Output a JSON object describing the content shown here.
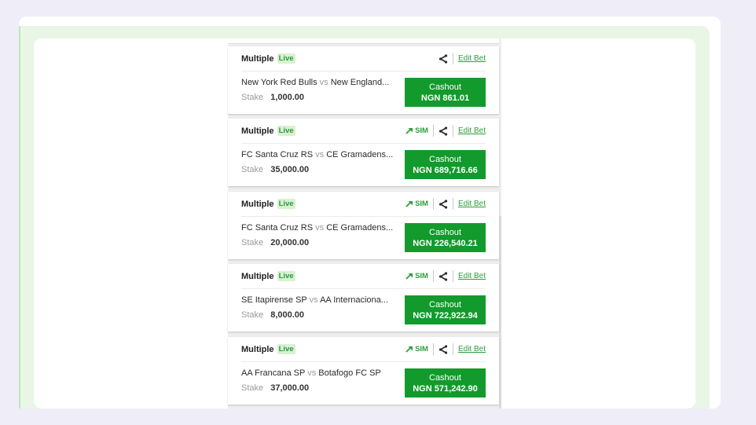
{
  "bets": [
    {
      "type": "Multiple",
      "live": "Live",
      "show_sim": false,
      "sim": "",
      "edit": "Edit Bet",
      "home": "New York Red Bulls",
      "vs": "vs",
      "away": "New England...",
      "stake_label": "Stake",
      "stake": "1,000.00",
      "cashout_label": "Cashout",
      "cashout_amount": "NGN 861.01"
    },
    {
      "type": "Multiple",
      "live": "Live",
      "show_sim": true,
      "sim": "SIM",
      "edit": "Edit Bet",
      "home": "FC Santa Cruz RS",
      "vs": "vs",
      "away": "CE Gramadens...",
      "stake_label": "Stake",
      "stake": "35,000.00",
      "cashout_label": "Cashout",
      "cashout_amount": "NGN 689,716.66"
    },
    {
      "type": "Multiple",
      "live": "Live",
      "show_sim": true,
      "sim": "SIM",
      "edit": "Edit Bet",
      "home": "FC Santa Cruz RS",
      "vs": "vs",
      "away": "CE Gramadens...",
      "stake_label": "Stake",
      "stake": "20,000.00",
      "cashout_label": "Cashout",
      "cashout_amount": "NGN 226,540.21"
    },
    {
      "type": "Multiple",
      "live": "Live",
      "show_sim": true,
      "sim": "SIM",
      "edit": "Edit Bet",
      "home": "SE Itapirense SP",
      "vs": "vs",
      "away": "AA Internaciona...",
      "stake_label": "Stake",
      "stake": "8,000.00",
      "cashout_label": "Cashout",
      "cashout_amount": "NGN 722,922.94"
    },
    {
      "type": "Multiple",
      "live": "Live",
      "show_sim": true,
      "sim": "SIM",
      "edit": "Edit Bet",
      "home": "AA Francana SP",
      "vs": "vs",
      "away": "Botafogo FC SP",
      "stake_label": "Stake",
      "stake": "37,000.00",
      "cashout_label": "Cashout",
      "cashout_amount": "NGN 571,242.90"
    }
  ],
  "icons": {
    "share": "share-icon",
    "sim": "arrow-up-right-icon"
  },
  "colors": {
    "accent": "#139a2c",
    "link": "#2d9f3b",
    "live_bg": "#d8f1d3",
    "frame": "#e9f6e6"
  }
}
